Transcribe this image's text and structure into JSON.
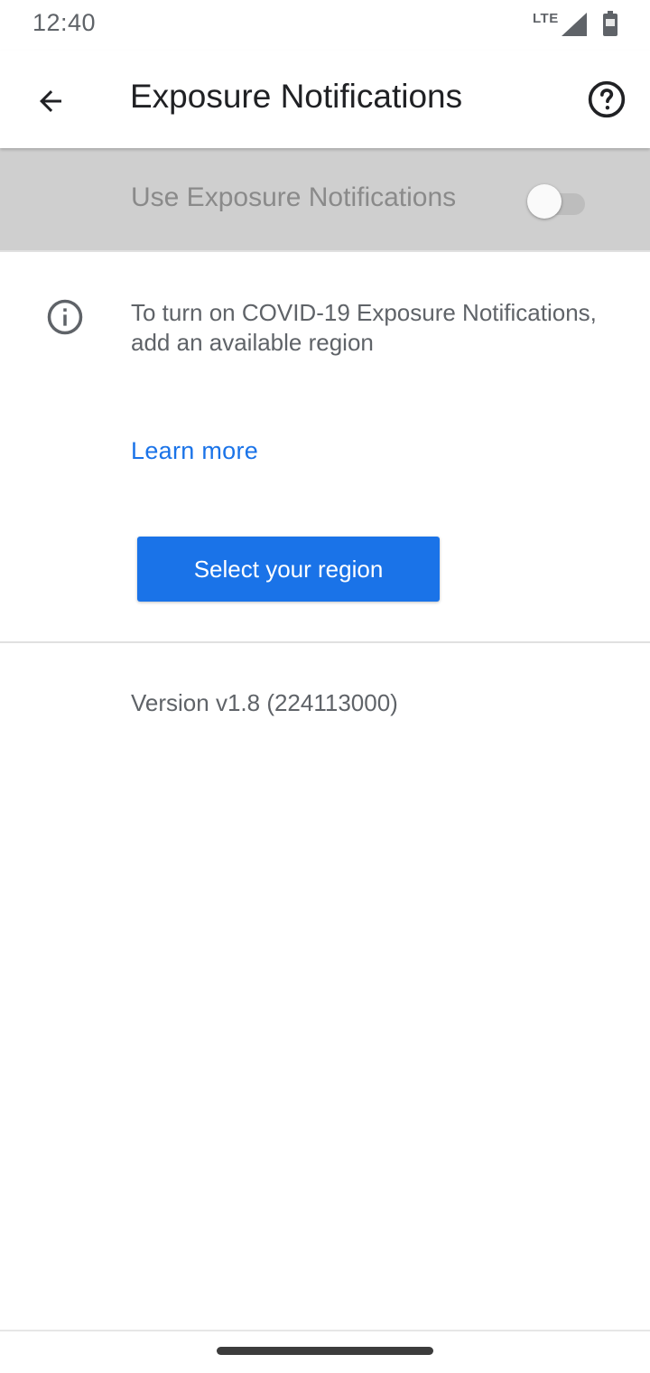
{
  "status_bar": {
    "time": "12:40",
    "network": "LTE"
  },
  "app_bar": {
    "title": "Exposure Notifications",
    "back_icon": "arrow-back-icon",
    "help_icon": "help-circle-icon"
  },
  "toggle": {
    "label": "Use Exposure Notifications",
    "checked": false
  },
  "info": {
    "icon": "info-icon",
    "text": "To turn on COVID-19 Exposure Notifications, add an available region"
  },
  "learn_more": "Learn more",
  "select_region_label": "Select your region",
  "version": "Version v1.8 (224113000)",
  "colors": {
    "accent": "#1a73e8",
    "disabled_bg": "#cfcfcf",
    "secondary_text": "#5f6368"
  }
}
